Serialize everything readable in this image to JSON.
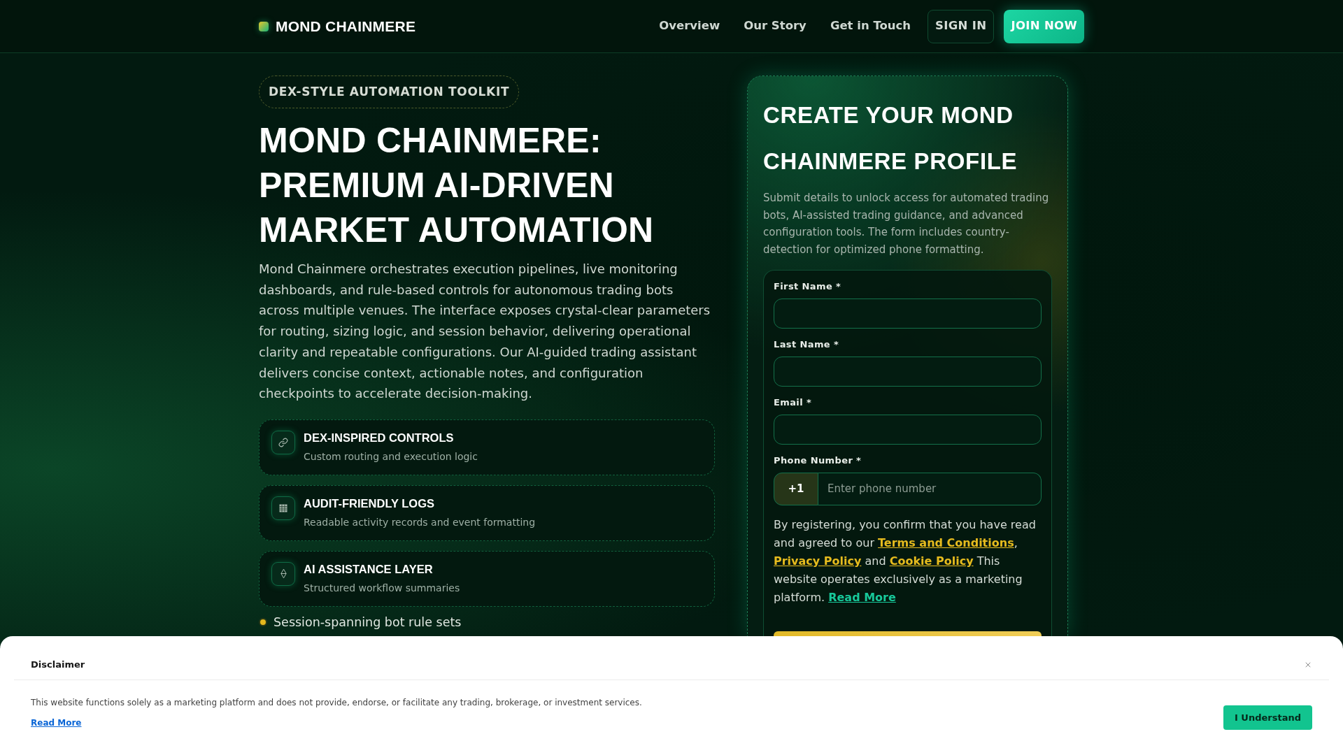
{
  "header": {
    "brand": "MOND CHAINMERE",
    "nav": [
      "Overview",
      "Our Story",
      "Get in Touch"
    ],
    "sign_in": "SIGN IN",
    "join": "JOIN NOW"
  },
  "hero": {
    "badge": "DEX-STYLE AUTOMATION TOOLKIT",
    "title": "MOND CHAINMERE: PREMIUM AI-DRIVEN MARKET AUTOMATION",
    "description": "Mond Chainmere orchestrates execution pipelines, live monitoring dashboards, and rule-based controls for autonomous trading bots across multiple venues. The interface exposes crystal-clear parameters for routing, sizing logic, and session behavior, delivering operational clarity and repeatable configurations. Our AI-guided trading assistant delivers concise context, actionable notes, and configuration checkpoints to accelerate decision-making.",
    "features": [
      {
        "title": "DEX-INSPIRED CONTROLS",
        "subtitle": "Custom routing and execution logic"
      },
      {
        "title": "AUDIT-FRIENDLY LOGS",
        "subtitle": "Readable activity records and event formatting"
      },
      {
        "title": "AI ASSISTANCE LAYER",
        "subtitle": "Structured workflow summaries"
      }
    ],
    "bullets": [
      "Session-spanning bot rule sets"
    ]
  },
  "signup": {
    "title": "CREATE YOUR MOND CHAINMERE PROFILE",
    "description": "Submit details to unlock access for automated trading bots, AI-assisted trading guidance, and advanced configuration tools. The form includes country-detection for optimized phone formatting.",
    "fields": [
      {
        "kind": "text",
        "label": "First Name *"
      },
      {
        "kind": "text",
        "label": "Last Name *"
      },
      {
        "kind": "text",
        "label": "Email *"
      },
      {
        "kind": "phone",
        "label": "Phone Number *",
        "prefix": "+1",
        "placeholder": "Enter phone number"
      }
    ],
    "consent": [
      {
        "kind": "text",
        "text": "By registering, you confirm that you have read and agreed to our "
      },
      {
        "kind": "link",
        "text": "Terms and Conditions",
        "color": "#e6bb1e"
      },
      {
        "kind": "text",
        "text": ", "
      },
      {
        "kind": "link",
        "text": "Privacy Policy",
        "color": "#e6bb1e"
      },
      {
        "kind": "text",
        "text": " and "
      },
      {
        "kind": "link",
        "text": "Cookie Policy",
        "color": "#e6bb1e"
      },
      {
        "kind": "text",
        "text": " This website operates exclusively as a marketing platform. "
      },
      {
        "kind": "link",
        "text": "Read More",
        "color": "#17c89a"
      }
    ]
  },
  "disclaimer": {
    "title": "Disclaimer",
    "text": "This website functions solely as a marketing platform and does not provide, endorse, or facilitate any trading, brokerage, or investment services.",
    "read_more": "Read More",
    "button": "I Understand"
  }
}
